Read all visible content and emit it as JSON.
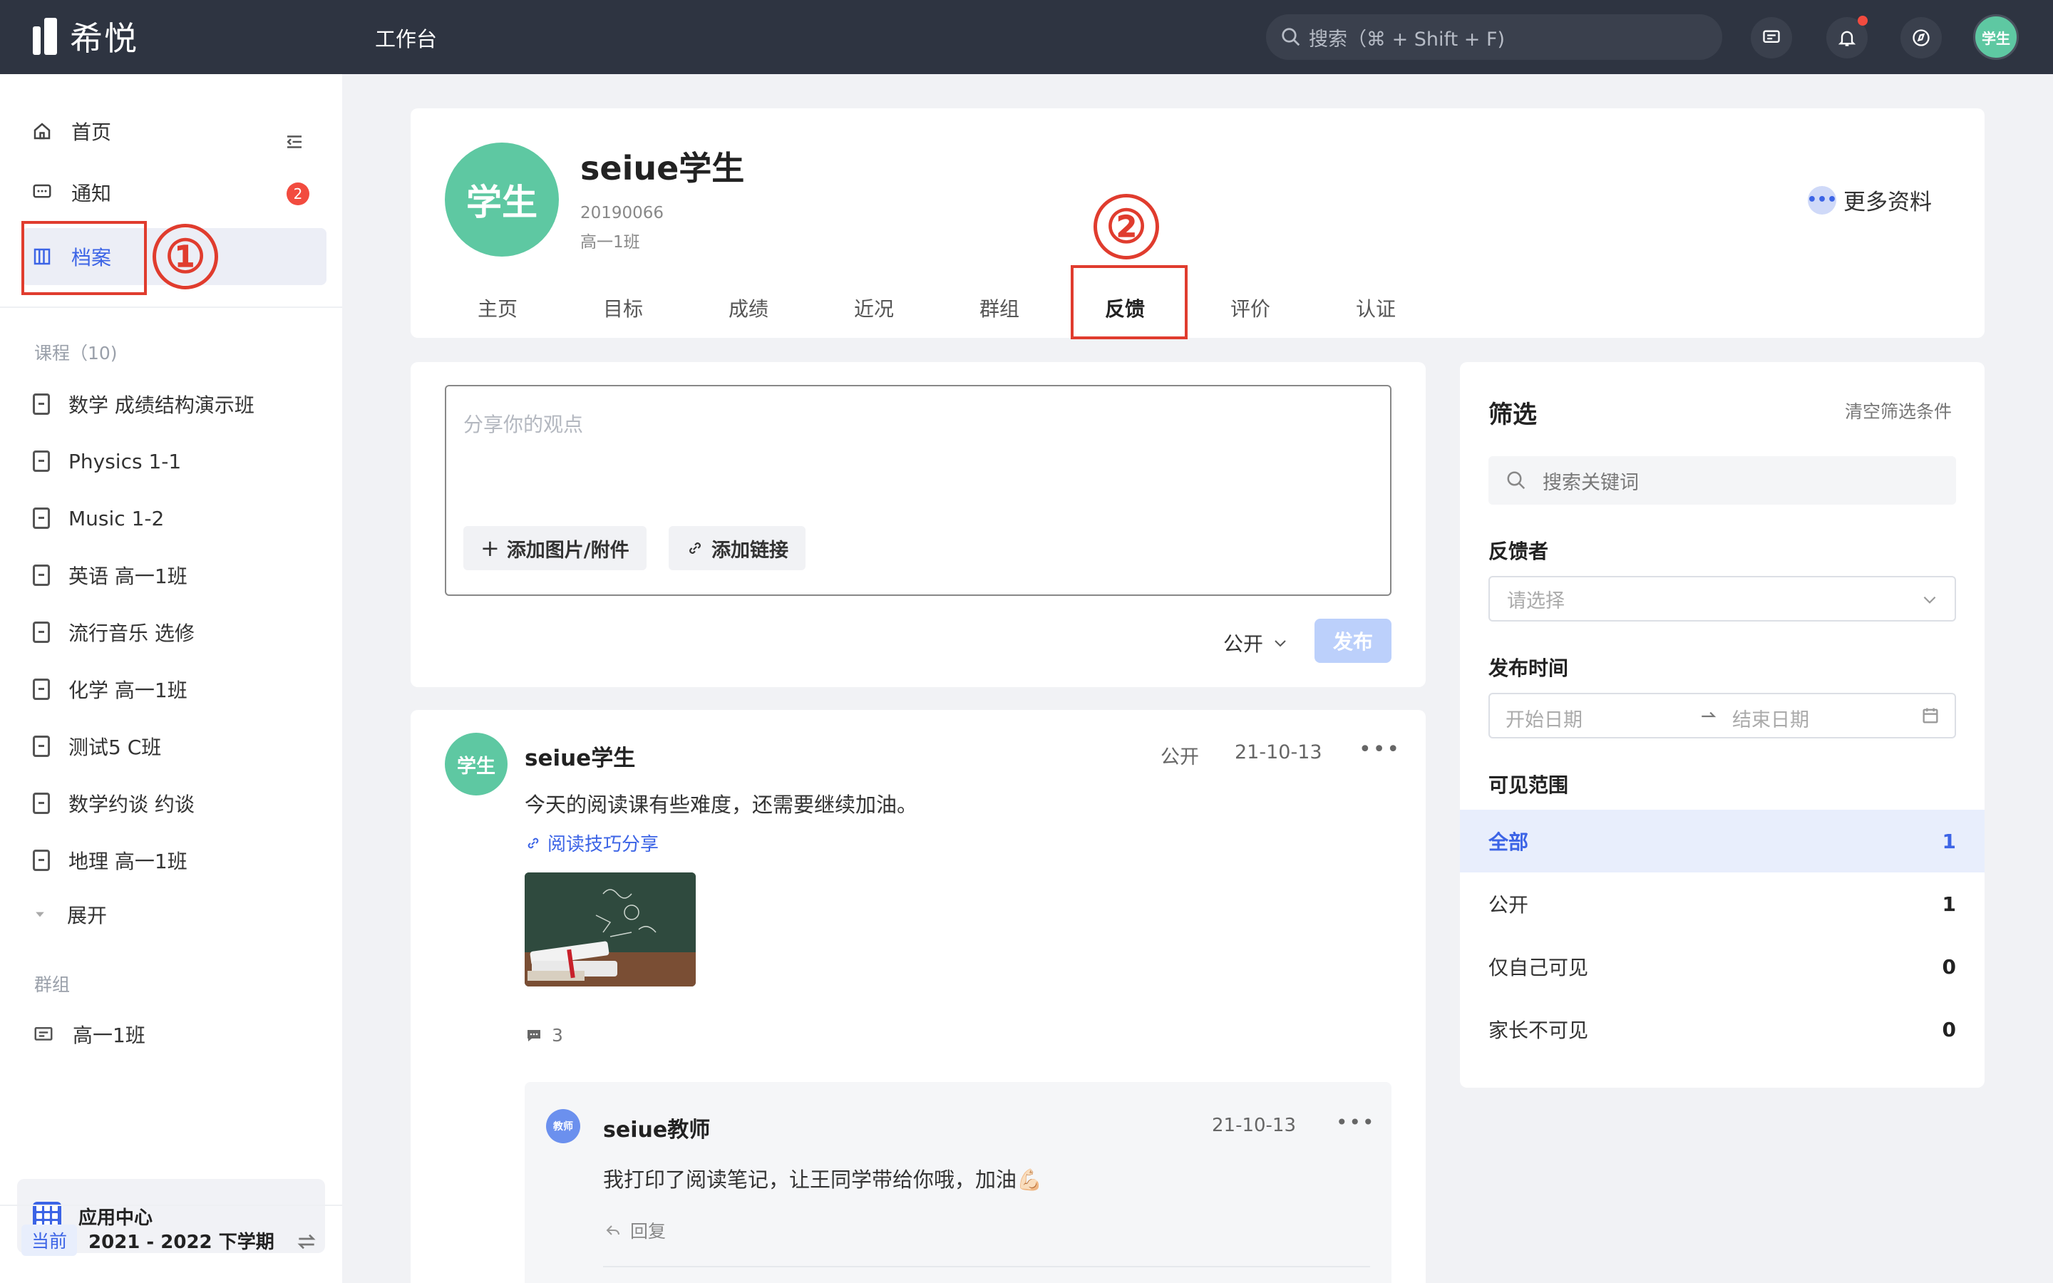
{
  "topbar": {
    "logo_text": "希悦",
    "title": "工作台",
    "search_placeholder": "搜索（⌘ + Shift + F)",
    "avatar_text": "学生"
  },
  "sidebar": {
    "nav": [
      {
        "label": "首页"
      },
      {
        "label": "通知",
        "badge": "2"
      },
      {
        "label": "档案"
      }
    ],
    "courses_title": "课程（10)",
    "courses": [
      "数学 成绩结构演示班",
      "Physics 1-1",
      "Music 1-2",
      "英语 高一1班",
      "流行音乐 选修",
      "化学 高一1班",
      "测试5 C班",
      "数学约谈 约谈",
      "地理 高一1班"
    ],
    "expand_label": "展开",
    "groups_title": "群组",
    "groups": [
      "高一1班"
    ],
    "app_center": "应用中心",
    "term_tag": "当前",
    "term": "2021 - 2022 下学期"
  },
  "annotations": {
    "one": "①",
    "two": "②"
  },
  "profile": {
    "avatar_text": "学生",
    "name": "seiue学生",
    "student_id": "20190066",
    "class_name": "高一1班",
    "more_info": "更多资料",
    "tabs": [
      "主页",
      "目标",
      "成绩",
      "近况",
      "群组",
      "反馈",
      "评价",
      "认证"
    ]
  },
  "composer": {
    "placeholder": "分享你的观点",
    "add_attachment": "添加图片/附件",
    "add_link": "添加链接",
    "visibility": "公开",
    "publish": "发布"
  },
  "post": {
    "avatar_text": "学生",
    "author": "seiue学生",
    "visibility": "公开",
    "date": "21-10-13",
    "text": "今天的阅读课有些难度，还需要继续加油。",
    "link": "阅读技巧分享",
    "comment_count": "3",
    "reply": {
      "avatar_text": "教师",
      "author": "seiue教师",
      "date": "21-10-13",
      "text": "我打印了阅读笔记，让王同学带给你哦，加油💪🏻",
      "action": "回复"
    }
  },
  "filter": {
    "title": "筛选",
    "clear": "清空筛选条件",
    "search_placeholder": "搜索关键词",
    "feedbacker_label": "反馈者",
    "feedbacker_placeholder": "请选择",
    "time_label": "发布时间",
    "start_date": "开始日期",
    "end_date": "结束日期",
    "scope_label": "可见范围",
    "scopes": [
      {
        "label": "全部",
        "count": "1"
      },
      {
        "label": "公开",
        "count": "1"
      },
      {
        "label": "仅自己可见",
        "count": "0"
      },
      {
        "label": "家长不可见",
        "count": "0"
      }
    ]
  },
  "colors": {
    "accent": "#3c64e6",
    "annotation": "#e03c2e",
    "avatar": "#5ec8a2",
    "topbar": "#2e3441"
  }
}
